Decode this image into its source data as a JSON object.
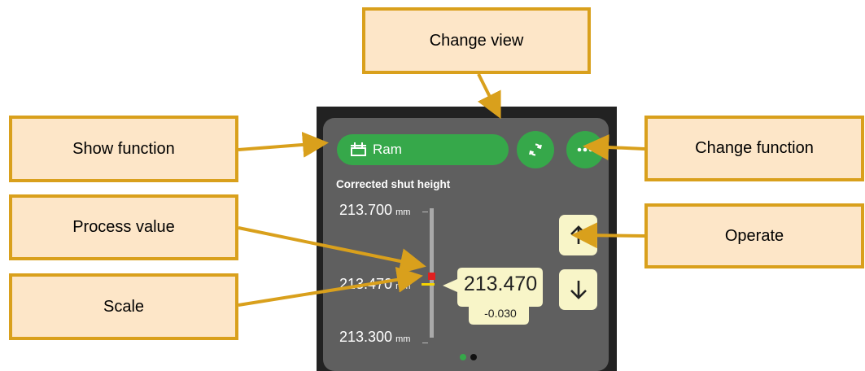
{
  "callouts": {
    "change_view": "Change view",
    "show_function": "Show function",
    "change_function": "Change function",
    "process_value": "Process value",
    "operate": "Operate",
    "scale": "Scale"
  },
  "device": {
    "function_label": "Ram",
    "measurement_title": "Corrected shut height",
    "scale": {
      "top": "213.700",
      "middle": "213.470",
      "bottom": "213.300",
      "unit": "mm"
    },
    "process_value": "213.470",
    "deviation": "-0.030",
    "page_count": 2,
    "active_page": 1
  },
  "colors": {
    "callout_fill": "#fde6c8",
    "callout_border": "#d9a01c",
    "accent_green": "#36a84a",
    "panel_bg": "#5f5f5f",
    "button_cream": "#f8f5c8",
    "marker_red": "#e02020",
    "marker_yellow": "#f5d400"
  },
  "icons": {
    "function": "ram-icon",
    "change_view": "refresh-icon",
    "change_function": "more-dots-icon",
    "operate_up": "arrow-up-icon",
    "operate_down": "arrow-down-icon"
  }
}
